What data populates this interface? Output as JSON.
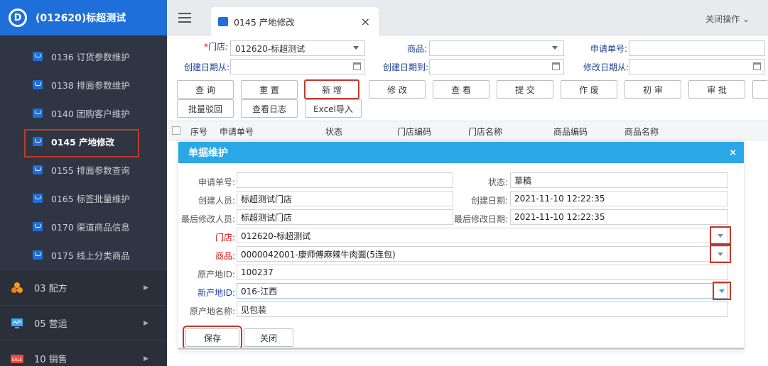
{
  "sidebar": {
    "brand": "(012620)标超测试",
    "logo_char": "D",
    "items": [
      {
        "label": "0136 订货参数维护"
      },
      {
        "label": "0138 排面参数维护"
      },
      {
        "label": "0140 团购客户维护"
      },
      {
        "label": "0145 产地修改"
      },
      {
        "label": "0155 排面参数查询"
      },
      {
        "label": "0165 标签批量维护"
      },
      {
        "label": "0170 渠道商品信息"
      },
      {
        "label": "0175 线上分类商品"
      }
    ],
    "groups": [
      {
        "label": "03 配方"
      },
      {
        "label": "05 营运"
      },
      {
        "label": "10 销售"
      }
    ],
    "active_item": "0145 产地修改",
    "colors": {
      "sidebar_bg": "#2f3542",
      "brand_bg": "#1e6fd9",
      "highlight": "#c0392b"
    }
  },
  "topbar": {
    "tab_label": "0145 产地修改",
    "tab_close": "×",
    "close_ops": "关闭操作 ⌄"
  },
  "filters": {
    "store_label": "门店:",
    "store_value": "012620-标超测试",
    "product_label": "商品:",
    "apply_no_label": "申请单号:",
    "created_from_label": "创建日期从:",
    "created_to_label": "创建日期到:",
    "modified_from_label": "修改日期从:"
  },
  "toolbar": {
    "row1": [
      "查 询",
      "重 置",
      "新 增",
      "修 改",
      "查 看",
      "提 交",
      "作 废",
      "初 审",
      "审 批"
    ],
    "row2": [
      "批量驳回",
      "查看日志",
      "Excel导入"
    ]
  },
  "table": {
    "columns": [
      "序号",
      "申请单号",
      "状态",
      "门店编码",
      "门店名称",
      "商品编码",
      "商品名称"
    ]
  },
  "modal": {
    "title": "单据维护",
    "close": "×",
    "fields": {
      "apply_no_label": "申请单号:",
      "apply_no_value": "",
      "status_label": "状态:",
      "status_value": "草稿",
      "creator_label": "创建人员:",
      "creator_value": "标超测试门店",
      "created_date_label": "创建日期:",
      "created_date_value": "2021-11-10 12:22:35",
      "last_modifier_label": "最后修改人员:",
      "last_modifier_value": "标超测试门店",
      "last_modified_label": "最后修改日期:",
      "last_modified_value": "2021-11-10 12:22:35",
      "store_label": "门店:",
      "store_value": "012620-标超测试",
      "product_label": "商品:",
      "product_value": "0000042001-康师傅麻辣牛肉面(5连包)",
      "origin_id_label": "原产地ID:",
      "origin_id_value": "100237",
      "new_origin_id_label": "新产地ID:",
      "new_origin_id_value": "016-江西",
      "origin_name_label": "原产地名称:",
      "origin_name_value": "见包装"
    },
    "save_label": "保存",
    "close_label": "关闭",
    "header_color": "#29a7e6"
  }
}
